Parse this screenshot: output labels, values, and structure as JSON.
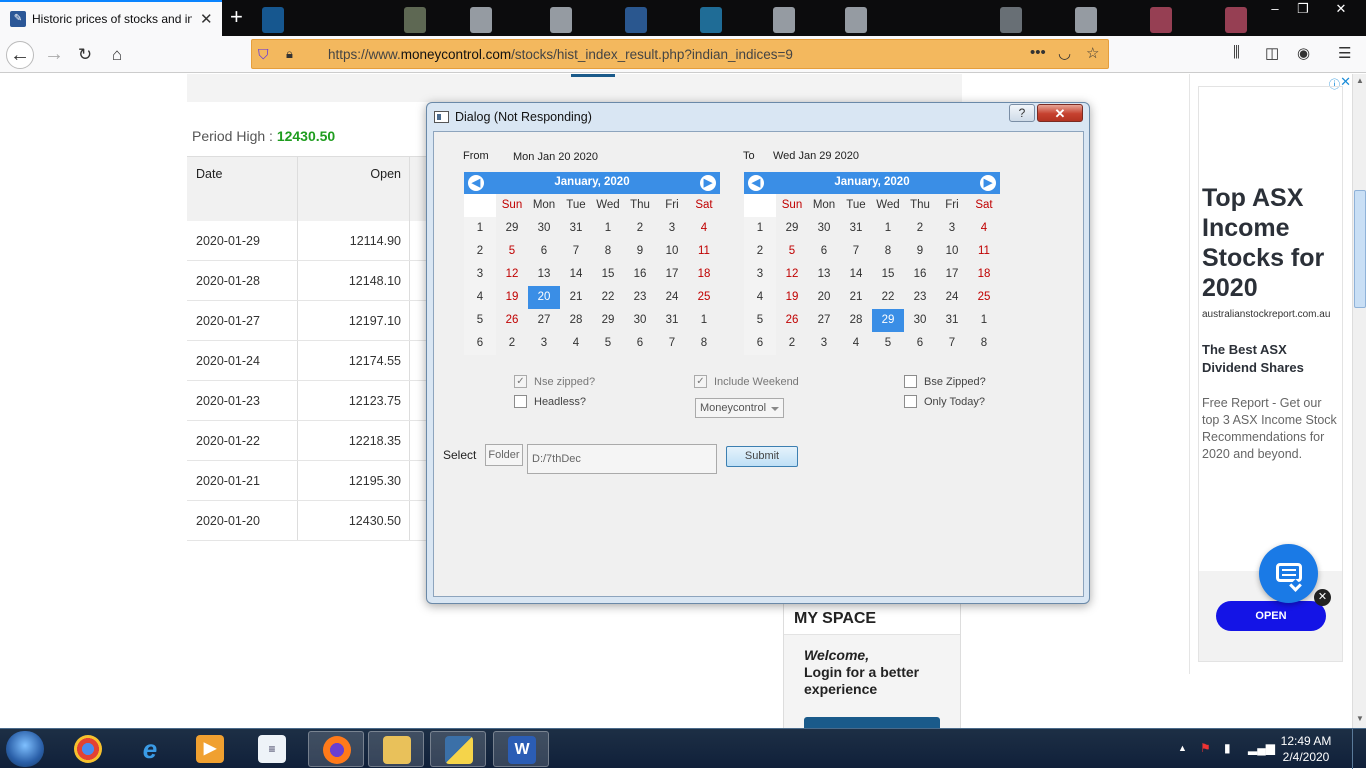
{
  "browser": {
    "tab_title": "Historic prices of stocks and ind",
    "url_prefix": "https://www.",
    "url_domain": "moneycontrol.com",
    "url_path": "/stocks/hist_index_result.php?indian_indices=9"
  },
  "page": {
    "period_high_label": "Period High : ",
    "period_high_value": "12430.50",
    "table": {
      "headers": [
        "Date",
        "Open"
      ],
      "rows": [
        [
          "2020-01-29",
          "12114.90"
        ],
        [
          "2020-01-28",
          "12148.10"
        ],
        [
          "2020-01-27",
          "12197.10"
        ],
        [
          "2020-01-24",
          "12174.55"
        ],
        [
          "2020-01-23",
          "12123.75"
        ],
        [
          "2020-01-22",
          "12218.35"
        ],
        [
          "2020-01-21",
          "12195.30"
        ],
        [
          "2020-01-20",
          "12430.50"
        ]
      ]
    },
    "myspace": {
      "title": "MY SPACE",
      "welcome": "Welcome,",
      "message": "Login for a better experience"
    }
  },
  "ad": {
    "headline": "Top ASX Income Stocks for 2020",
    "domain": "australianstockreport.com.au",
    "subhead": "The Best ASX Dividend Shares",
    "description": "Free Report - Get our top 3 ASX Income Stock Recommendations for 2020 and beyond.",
    "open_label": "OPEN"
  },
  "dialog": {
    "title": "Dialog (Not Responding)",
    "help_label": "?",
    "from_label": "From",
    "from_date": "Mon Jan 20 2020",
    "to_label": "To",
    "to_date": "Wed Jan 29 2020",
    "calendar_from": {
      "month_label": "January,  2020",
      "weekdays": [
        "Sun",
        "Mon",
        "Tue",
        "Wed",
        "Thu",
        "Fri",
        "Sat"
      ],
      "weeks": [
        {
          "num": "1",
          "days": [
            "29",
            "30",
            "31",
            "1",
            "2",
            "3",
            "4"
          ]
        },
        {
          "num": "2",
          "days": [
            "5",
            "6",
            "7",
            "8",
            "9",
            "10",
            "11"
          ]
        },
        {
          "num": "3",
          "days": [
            "12",
            "13",
            "14",
            "15",
            "16",
            "17",
            "18"
          ]
        },
        {
          "num": "4",
          "days": [
            "19",
            "20",
            "21",
            "22",
            "23",
            "24",
            "25"
          ]
        },
        {
          "num": "5",
          "days": [
            "26",
            "27",
            "28",
            "29",
            "30",
            "31",
            "1"
          ]
        },
        {
          "num": "6",
          "days": [
            "2",
            "3",
            "4",
            "5",
            "6",
            "7",
            "8"
          ]
        }
      ],
      "selected": "20"
    },
    "calendar_to": {
      "month_label": "January,  2020",
      "weekdays": [
        "Sun",
        "Mon",
        "Tue",
        "Wed",
        "Thu",
        "Fri",
        "Sat"
      ],
      "weeks": [
        {
          "num": "1",
          "days": [
            "29",
            "30",
            "31",
            "1",
            "2",
            "3",
            "4"
          ]
        },
        {
          "num": "2",
          "days": [
            "5",
            "6",
            "7",
            "8",
            "9",
            "10",
            "11"
          ]
        },
        {
          "num": "3",
          "days": [
            "12",
            "13",
            "14",
            "15",
            "16",
            "17",
            "18"
          ]
        },
        {
          "num": "4",
          "days": [
            "19",
            "20",
            "21",
            "22",
            "23",
            "24",
            "25"
          ]
        },
        {
          "num": "5",
          "days": [
            "26",
            "27",
            "28",
            "29",
            "30",
            "31",
            "1"
          ]
        },
        {
          "num": "6",
          "days": [
            "2",
            "3",
            "4",
            "5",
            "6",
            "7",
            "8"
          ]
        }
      ],
      "selected": "29"
    },
    "checkboxes": {
      "nse_zipped": {
        "label": "Nse zipped?",
        "checked": true
      },
      "headless": {
        "label": "Headless?",
        "checked": false
      },
      "include_weekend": {
        "label": "Include Weekend",
        "checked": true
      },
      "bse_zipped": {
        "label": "Bse Zipped?",
        "checked": false
      },
      "only_today": {
        "label": "Only Today?",
        "checked": false
      }
    },
    "source_select": "Moneycontrol",
    "select_label": "Select",
    "folder_button": "Folder",
    "path_value": "D:/7thDec",
    "submit_label": "Submit"
  },
  "taskbar": {
    "time": "12:49 AM",
    "date": "2/4/2020"
  },
  "colors": {
    "calendar_accent": "#3a8ee6",
    "weekend_red": "#c00000",
    "period_high_green": "#1f9d1f",
    "url_bar_orange": "#f3b85e"
  }
}
